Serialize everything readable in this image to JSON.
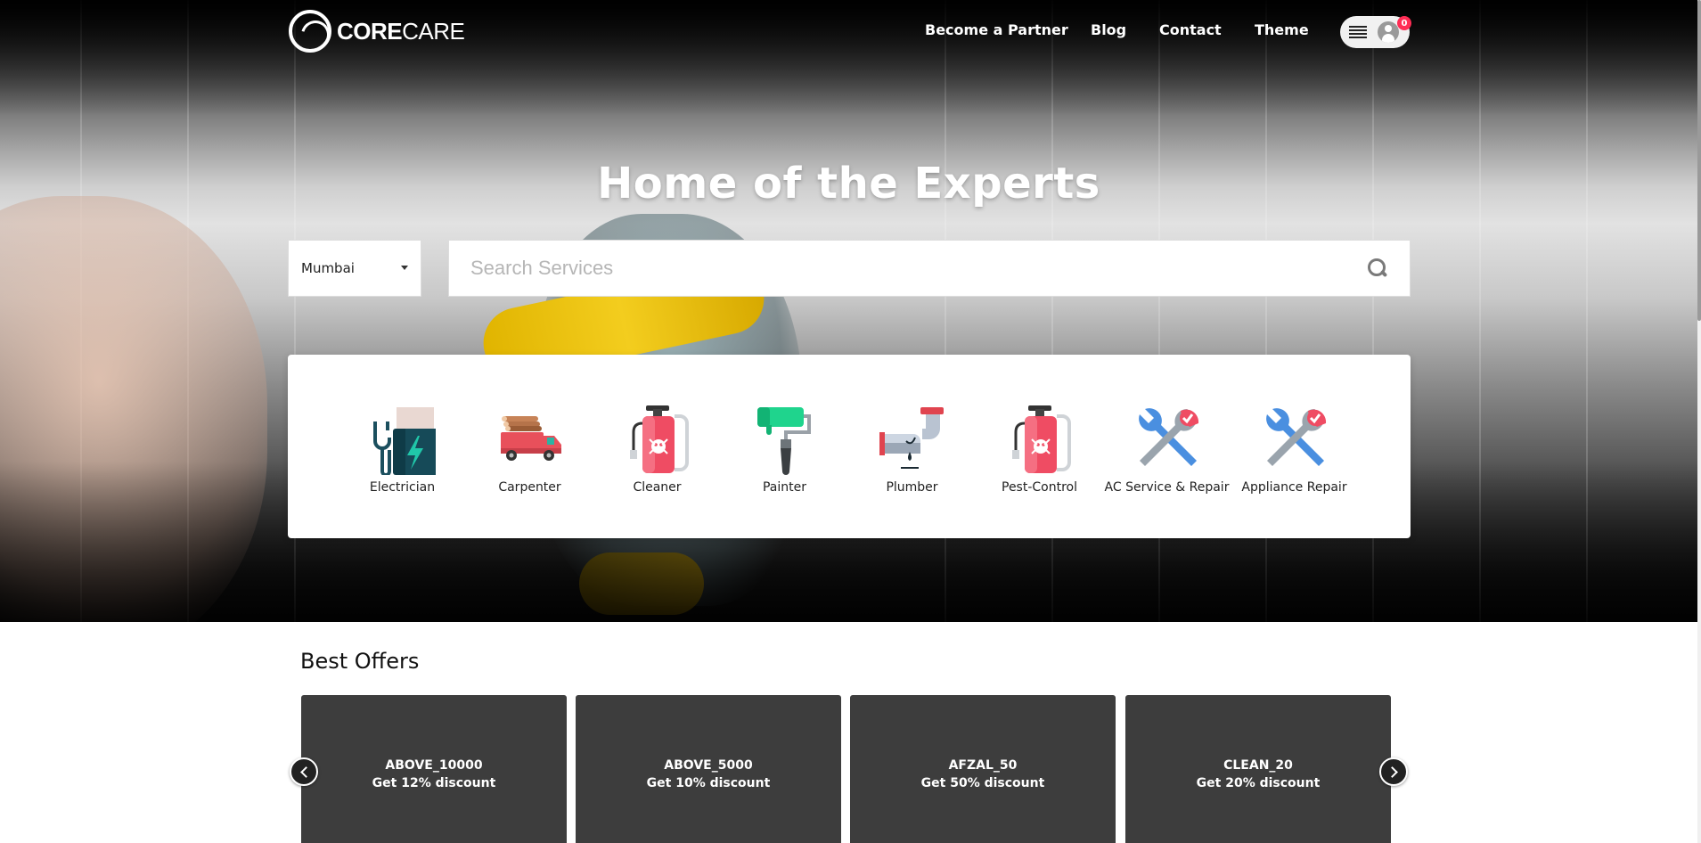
{
  "brand": {
    "name_bold": "CORE",
    "name_light": "CARE"
  },
  "nav": {
    "links": [
      "Become a Partner",
      "Blog",
      "Contact",
      "Theme"
    ],
    "cart_count": "0"
  },
  "hero": {
    "title": "Home of the Experts",
    "city": "Mumbai",
    "search_placeholder": "Search Services"
  },
  "services": [
    {
      "label": "Electrician",
      "icon": "electrician-icon"
    },
    {
      "label": "Carpenter",
      "icon": "carpenter-truck-icon"
    },
    {
      "label": "Cleaner",
      "icon": "cleaner-sprayer-icon"
    },
    {
      "label": "Painter",
      "icon": "paint-roller-icon"
    },
    {
      "label": "Plumber",
      "icon": "plumber-pipe-icon"
    },
    {
      "label": "Pest-Control",
      "icon": "pest-sprayer-icon"
    },
    {
      "label": "AC Service & Repair",
      "icon": "wrench-icon"
    },
    {
      "label": "Appliance Repair",
      "icon": "wrench-icon"
    }
  ],
  "offers": {
    "title": "Best Offers",
    "items": [
      {
        "code": "ABOVE_10000",
        "desc": "Get 12% discount"
      },
      {
        "code": "ABOVE_5000",
        "desc": "Get 10% discount"
      },
      {
        "code": "AFZAL_50",
        "desc": "Get 50% discount"
      },
      {
        "code": "CLEAN_20",
        "desc": "Get 20% discount"
      }
    ]
  },
  "colors": {
    "offer_card": "#3d3d3d",
    "badge": "#ff2d55",
    "accent_red": "#f0506e",
    "accent_teal": "#1fb6a6"
  }
}
